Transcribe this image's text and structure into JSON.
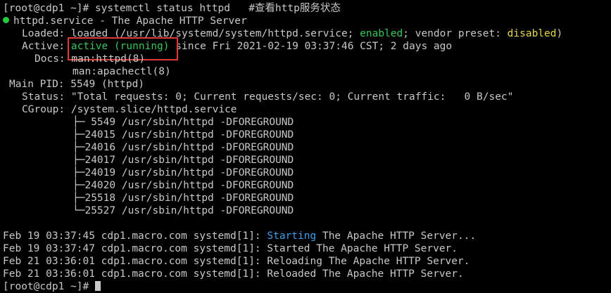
{
  "prompt_cmd": "[root@cdp1 ~]# systemctl status httpd   #查看http服务状态",
  "svc": {
    "title": "httpd.service - The Apache HTTP Server",
    "loaded_prefix": "Loaded: loaded (/usr/lib/systemd/system/httpd.service; ",
    "loaded_enabled": "enabled",
    "loaded_mid": "; vendor preset: ",
    "loaded_disabled": "disabled",
    "loaded_suffix": ")",
    "active_label": "Active:",
    "active_state": "active (running)",
    "active_since": "since Fri 2021-02-19 03:37:46 CST; 2 days ago",
    "docs1": "Docs: man:httpd(8)",
    "docs2": "man:apachectl(8)",
    "mainpid": "Main PID: 5549 (httpd)",
    "status": "Status: \"Total requests: 0; Current requests/sec: 0; Current traffic:   0 B/sec\"",
    "cgroup": "CGroup: /system.slice/httpd.service",
    "processes": [
      "├─ 5549 /usr/sbin/httpd -DFOREGROUND",
      "├─24015 /usr/sbin/httpd -DFOREGROUND",
      "├─24016 /usr/sbin/httpd -DFOREGROUND",
      "├─24017 /usr/sbin/httpd -DFOREGROUND",
      "├─24019 /usr/sbin/httpd -DFOREGROUND",
      "├─24020 /usr/sbin/httpd -DFOREGROUND",
      "├─25518 /usr/sbin/httpd -DFOREGROUND",
      "└─25527 /usr/sbin/httpd -DFOREGROUND"
    ]
  },
  "logs": [
    {
      "prefix": "Feb 19 03:37:45 cdp1.macro.com systemd[1]: ",
      "hl": "Starting",
      "rest": " The Apache HTTP Server..."
    },
    {
      "prefix": "Feb 19 03:37:47 cdp1.macro.com systemd[1]: ",
      "hl": "",
      "rest": "Started The Apache HTTP Server."
    },
    {
      "prefix": "Feb 21 03:36:01 cdp1.macro.com systemd[1]: ",
      "hl": "",
      "rest": "Reloading The Apache HTTP Server."
    },
    {
      "prefix": "Feb 21 03:36:01 cdp1.macro.com systemd[1]: ",
      "hl": "",
      "rest": "Reloaded The Apache HTTP Server."
    }
  ],
  "final_prompt": "[root@cdp1 ~]# ",
  "colors": {
    "background": "#000000",
    "text": "#c8c8c8",
    "green": "#34c759",
    "yellow": "#e6d84a",
    "blue": "#3aa0f0",
    "highlight_box": "#e53935"
  }
}
